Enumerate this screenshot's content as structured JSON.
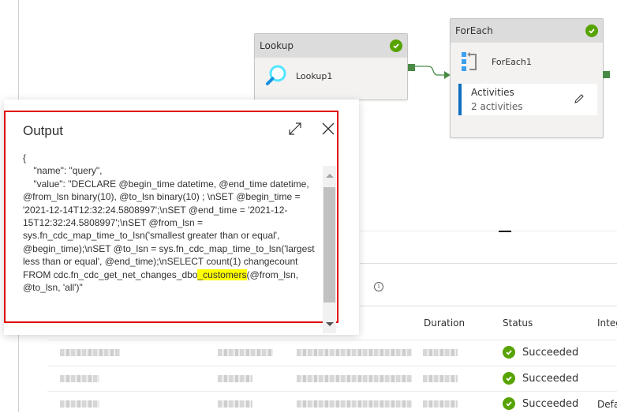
{
  "pipeline": {
    "lookup_activity": {
      "type_label": "Lookup",
      "name": "Lookup1",
      "status": "succeeded",
      "icon": "magnifier-icon"
    },
    "foreach_activity": {
      "type_label": "ForEach",
      "name": "ForEach1",
      "status": "succeeded",
      "icon": "foreach-loop-icon",
      "activities_label": "Activities",
      "activities_count": "2 activities"
    },
    "colors": {
      "success": "#57a300",
      "connector": "#498b45",
      "accent": "#106ebe",
      "highlight_frame": "#e00000",
      "text_highlight": "#ffff00"
    }
  },
  "output_dialog": {
    "title": "Output",
    "content_before_highlight": "{\n    \"name\": \"query\",\n    \"value\": \"DECLARE @begin_time datetime, @end_time datetime, @from_lsn binary(10), @to_lsn binary(10) ; \\nSET @begin_time = '2021-12-14T12:32:24.5808997';\\nSET @end_time = '2021-12-15T12:32:24.5808997';\\nSET @from_lsn = sys.fn_cdc_map_time_to_lsn('smallest greater than or equal', @begin_time);\\nSET @to_lsn = sys.fn_cdc_map_time_to_lsn('largest less than or equal', @end_time);\\nSELECT count(1) changecount FROM cdc.fn_cdc_get_net_changes_dbo",
    "content_highlight": "_customers",
    "content_after_highlight": "(@from_lsn, @to_lsn, 'all')\"",
    "expand_icon": "expand-icon",
    "close_icon": "close-icon"
  },
  "runs_table": {
    "columns": [
      "Duration",
      "Status",
      "Integ"
    ],
    "rows": [
      {
        "status": "Succeeded",
        "integration_runtime": ""
      },
      {
        "status": "Succeeded",
        "integration_runtime": ""
      },
      {
        "status": "Succeeded",
        "integration_runtime": "Defa"
      }
    ]
  }
}
